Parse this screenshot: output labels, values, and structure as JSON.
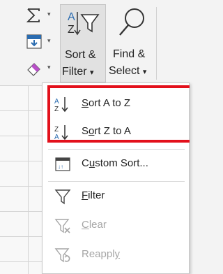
{
  "ribbon": {
    "autosum_icon": "sigma-icon",
    "fill_icon": "fill-down-icon",
    "clear_icon": "eraser-icon",
    "sort_filter": {
      "line1": "Sort &",
      "line2": "Filter",
      "icon": "sort-az-filter-icon"
    },
    "find_select": {
      "line1": "Find &",
      "line2": "Select",
      "icon": "magnifier-icon"
    }
  },
  "menu": {
    "items": [
      {
        "pre": "",
        "key": "S",
        "post": "ort A to Z",
        "icon": "sort-a-to-z-icon",
        "enabled": true
      },
      {
        "pre": "S",
        "key": "o",
        "post": "rt Z to A",
        "icon": "sort-z-to-a-icon",
        "enabled": true
      },
      {
        "pre": "C",
        "key": "u",
        "post": "stom Sort...",
        "icon": "custom-sort-icon",
        "enabled": true
      },
      {
        "pre": "",
        "key": "F",
        "post": "ilter",
        "icon": "filter-icon",
        "enabled": true
      },
      {
        "pre": "",
        "key": "C",
        "post": "lear",
        "icon": "clear-filter-icon",
        "enabled": false
      },
      {
        "pre": "Reappl",
        "key": "y",
        "post": "",
        "icon": "reapply-icon",
        "enabled": false
      }
    ]
  },
  "colors": {
    "highlight": "#e3101b",
    "accent": "#2b6cb0",
    "disabled": "#a6a6a6"
  }
}
